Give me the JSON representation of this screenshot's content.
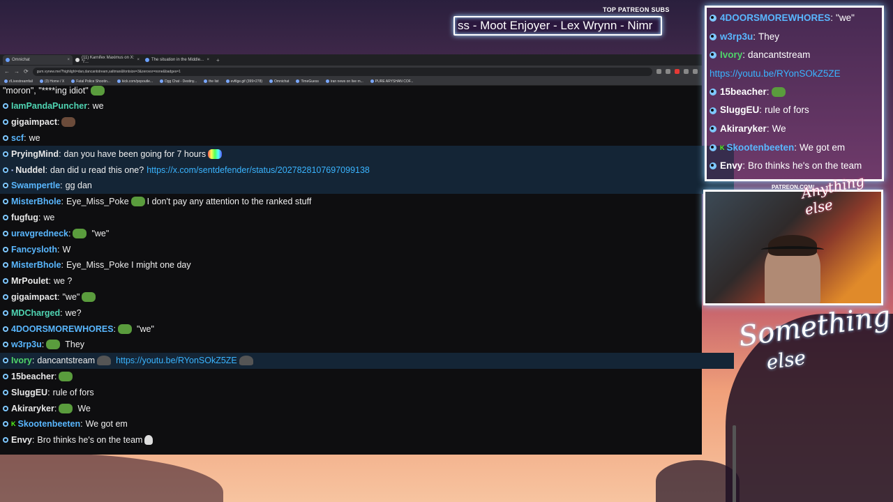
{
  "patreon": {
    "label": "TOP PATREON SUBS",
    "ticker": "ss - Moot Enjoyer - Lex Wrynn - Nimr"
  },
  "browser": {
    "tabs": [
      {
        "label": "Omnichat",
        "active": true
      },
      {
        "label": "(11) Karnifex Maximus on X: \"I'...",
        "active": false
      },
      {
        "label": "The situation in the Middle...",
        "active": false
      }
    ],
    "new_tab": "+",
    "url": "gum.vynew.me/?highlight=dan,dancantstream,saltman&fontsize=3&zerovsr=none&badges=1",
    "bookmarks": [
      "r/Livestreamfail",
      "(3) Home / X",
      "Fatal Police Shootin...",
      "kick.com/popoutle...",
      "Dgg Chat - Destiny...",
      "the list",
      "evfilge.gif (399×278)",
      "Omnichat",
      "TimeGuess",
      "iran news on live m...",
      "PURE ARYSHAN COF..."
    ]
  },
  "chat": {
    "first_line": "\"moron\", \"****ing idiot\"",
    "messages": [
      {
        "user": "IamPandaPuncher",
        "color": "#4fd4b2",
        "text": "we",
        "emote": ""
      },
      {
        "user": "gigaimpact",
        "color": "#e8e8e8",
        "text": "",
        "emote": "dark"
      },
      {
        "user": "scf",
        "color": "#59b7ff",
        "text": "we",
        "emote": ""
      },
      {
        "user": "PryingMind",
        "color": "#e8e8e8",
        "text": "dan you have been going for 7 hours",
        "emote": "rainbow",
        "hl": true
      },
      {
        "user": "Nuddel",
        "color": "#e8e8e8",
        "text": "dan did u read this one?",
        "link": "https://x.com/sentdefender/status/2027828107697099138",
        "badge": "s",
        "hl": true
      },
      {
        "user": "Swampertle",
        "color": "#59b7ff",
        "text": "gg dan",
        "emote": "",
        "hl": true
      },
      {
        "user": "MisterBhole",
        "color": "#59b7ff",
        "text": "Eye_Miss_Poke",
        "text2": "I don't pay any attention to the ranked stuff",
        "emote": "frog"
      },
      {
        "user": "fugfug",
        "color": "#e8e8e8",
        "text": "we",
        "emote": ""
      },
      {
        "user": "uravgredneck",
        "color": "#59b7ff",
        "text": "\"we\"",
        "emote": "frog",
        "pre": true
      },
      {
        "user": "Fancysloth",
        "color": "#59b7ff",
        "text": "W",
        "emote": ""
      },
      {
        "user": "MisterBhole",
        "color": "#59b7ff",
        "text": "Eye_Miss_Poke I might one day",
        "emote": ""
      },
      {
        "user": "MrPoulet",
        "color": "#e8e8e8",
        "text": "we ?",
        "emote": ""
      },
      {
        "user": "gigaimpact",
        "color": "#e8e8e8",
        "text": "\"we\"",
        "emote": "frog"
      },
      {
        "user": "MDCharged",
        "color": "#4fd4b2",
        "text": "we?",
        "emote": ""
      },
      {
        "user": "4DOORSMOREWHORES",
        "color": "#59b7ff",
        "text": "\"we\"",
        "emote": "frog",
        "pre": true
      },
      {
        "user": "w3rp3u",
        "color": "#59b7ff",
        "text": "They",
        "emote": "frog",
        "pre": true
      },
      {
        "user": "Ivory",
        "color": "#4fd46a",
        "text": "dancantstream",
        "link": "https://youtu.be/RYonSOkZ5ZE",
        "emote": "hat",
        "hl": true
      },
      {
        "user": "15beacher",
        "color": "#e8e8e8",
        "text": "",
        "emote": "frog"
      },
      {
        "user": "SluggEU",
        "color": "#e8e8e8",
        "text": "rule of fors",
        "emote": ""
      },
      {
        "user": "Akiraryker",
        "color": "#e8e8e8",
        "text": "We",
        "emote": "frog",
        "pre": true
      },
      {
        "user": "Skootenbeeten",
        "color": "#59b7ff",
        "text": "We got em",
        "emote": "",
        "badge": "k"
      },
      {
        "user": "Envy",
        "color": "#e8e8e8",
        "text": "Bro thinks he's on the team",
        "emote": "skull"
      }
    ]
  },
  "overlay": {
    "messages": [
      {
        "user": "4DOORSMOREWHORES",
        "color": "#59b7ff",
        "text": "\"we\""
      },
      {
        "user": "w3rp3u",
        "color": "#59b7ff",
        "text": "They"
      },
      {
        "user": "Ivory",
        "color": "#4fd46a",
        "text": "dancantstream"
      },
      {
        "link": "https://youtu.be/RYonSOkZ5ZE"
      },
      {
        "user": "15beacher",
        "color": "#ffffff",
        "text": ""
      },
      {
        "user": "SluggEU",
        "color": "#ffffff",
        "text": "rule of fors"
      },
      {
        "user": "Akiraryker",
        "color": "#ffffff",
        "text": "We"
      },
      {
        "user": "Skootenbeeten",
        "color": "#59b7ff",
        "text": "We got em",
        "badge": "k"
      },
      {
        "user": "Envy",
        "color": "#ffffff",
        "text": "Bro thinks he's on the team"
      }
    ]
  },
  "webcam": {
    "label": "PATREON.COM/",
    "brand": "Anything else"
  },
  "brand": {
    "line1": "Something",
    "line2": "else"
  }
}
